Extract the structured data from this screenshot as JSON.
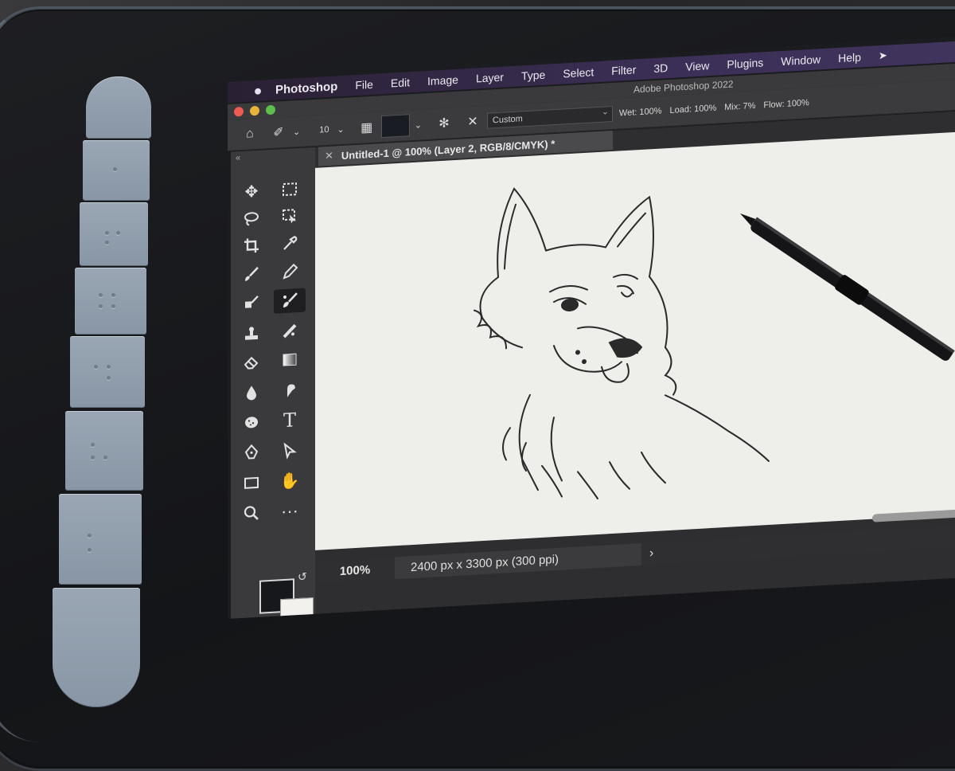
{
  "menu": {
    "app": "Photoshop",
    "items": [
      "File",
      "Edit",
      "Image",
      "Layer",
      "Type",
      "Select",
      "Filter",
      "3D",
      "View",
      "Plugins",
      "Window",
      "Help"
    ]
  },
  "window": {
    "title": "Adobe Photoshop 2022"
  },
  "options": {
    "brush_size": "10",
    "preset": "Custom",
    "wet": "Wet: 100%",
    "load": "Load: 100%",
    "mix": "Mix: 7%",
    "flow": "Flow: 100%"
  },
  "document": {
    "tab_title": "Untitled-1 @ 100% (Layer 2, RGB/8/CMYK) *",
    "zoom": "100%",
    "info": "2400 px x 3300 px (300 ppi)"
  },
  "colors": {
    "foreground": "#17181c",
    "background": "#f2f1ee",
    "menubar": "#3c2f57",
    "tablet_keys": "#8f9cab"
  },
  "icons": [
    "apple-icon",
    "home-icon",
    "mixer-brush-icon",
    "brush-preset-icon",
    "swatch-icon",
    "clean-brush-icon",
    "move-icon",
    "marquee-icon",
    "lasso-icon",
    "object-select-icon",
    "crop-icon",
    "eyedropper-icon",
    "brush-icon",
    "pencil-icon",
    "eraser-icon",
    "gradient-icon",
    "blur-icon",
    "smudge-icon",
    "stamp-icon",
    "history-brush-icon",
    "sponge-icon",
    "type-icon",
    "pen-icon",
    "path-select-icon",
    "rectangle-icon",
    "hand-icon",
    "zoom-icon",
    "more-icon",
    "swap-icon",
    "default-colors-icon",
    "quick-mask-icon",
    "screen-mode-icon"
  ]
}
